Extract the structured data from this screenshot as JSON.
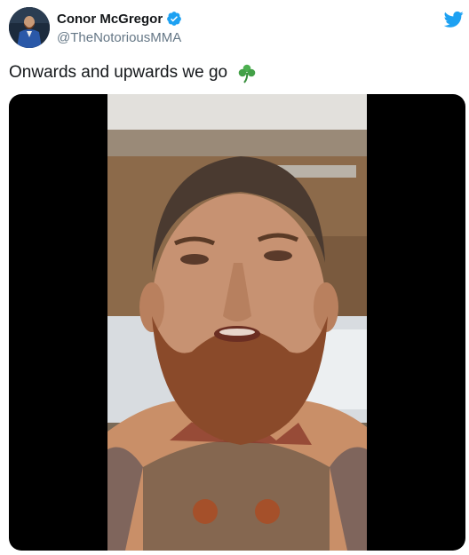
{
  "tweet": {
    "author": {
      "display_name": "Conor McGregor",
      "handle": "@TheNotoriousMMA",
      "verified": true,
      "avatar_icon": "profile-photo"
    },
    "text": "Onwards and upwards we go",
    "emoji": "shamrock-icon",
    "platform_icon": "twitter-bird-icon",
    "colors": {
      "brand": "#1da1f2",
      "name": "#14171a",
      "handle": "#657786",
      "shamrock": "#4caf50"
    }
  }
}
